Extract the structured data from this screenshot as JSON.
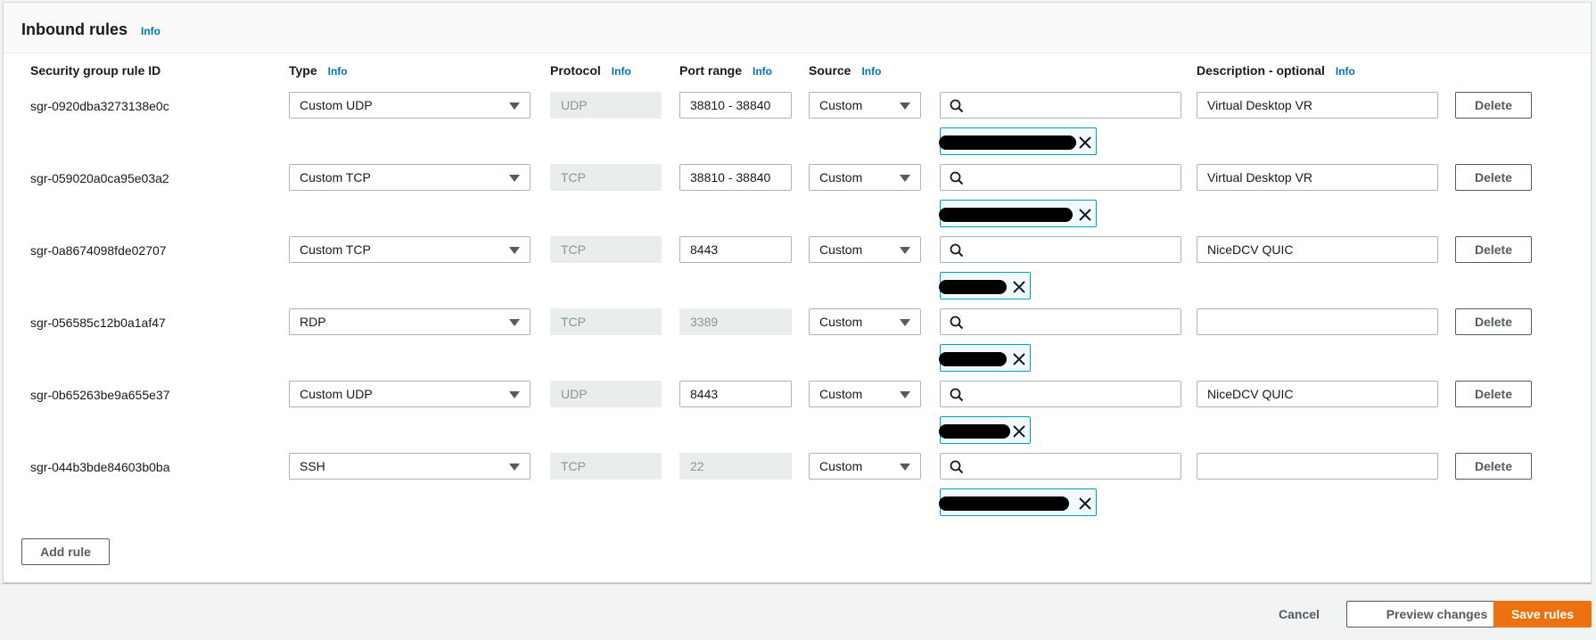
{
  "panel": {
    "title": "Inbound rules",
    "title_info": "Info"
  },
  "columns": {
    "rule_id": "Security group rule ID",
    "type": "Type",
    "type_info": "Info",
    "protocol": "Protocol",
    "protocol_info": "Info",
    "port_range": "Port range",
    "port_range_info": "Info",
    "source": "Source",
    "source_info": "Info",
    "description": "Description - optional",
    "description_info": "Info"
  },
  "rules": [
    {
      "id": "sgr-0920dba3273138e0c",
      "type": "Custom UDP",
      "protocol": "UDP",
      "port_range": "38810 - 38840",
      "port_editable": true,
      "source": "Custom",
      "description": "Virtual Desktop VR",
      "delete_label": "Delete"
    },
    {
      "id": "sgr-059020a0ca95e03a2",
      "type": "Custom TCP",
      "protocol": "TCP",
      "port_range": "38810 - 38840",
      "port_editable": true,
      "source": "Custom",
      "description": "Virtual Desktop VR",
      "delete_label": "Delete"
    },
    {
      "id": "sgr-0a8674098fde02707",
      "type": "Custom TCP",
      "protocol": "TCP",
      "port_range": "8443",
      "port_editable": true,
      "source": "Custom",
      "description": "NiceDCV QUIC",
      "delete_label": "Delete"
    },
    {
      "id": "sgr-056585c12b0a1af47",
      "type": "RDP",
      "protocol": "TCP",
      "port_range": "3389",
      "port_editable": false,
      "source": "Custom",
      "description": "",
      "delete_label": "Delete"
    },
    {
      "id": "sgr-0b65263be9a655e37",
      "type": "Custom UDP",
      "protocol": "UDP",
      "port_range": "8443",
      "port_editable": true,
      "source": "Custom",
      "description": "NiceDCV QUIC",
      "delete_label": "Delete"
    },
    {
      "id": "sgr-044b3bde84603b0ba",
      "type": "SSH",
      "protocol": "TCP",
      "port_range": "22",
      "port_editable": false,
      "source": "Custom",
      "description": "",
      "delete_label": "Delete"
    }
  ],
  "add_rule_label": "Add rule",
  "footer": {
    "cancel": "Cancel",
    "preview": "Preview changes",
    "save": "Save rules"
  },
  "colors": {
    "link": "#0073bb",
    "primary": "#ec7211",
    "token_border": "#00a1c9"
  }
}
